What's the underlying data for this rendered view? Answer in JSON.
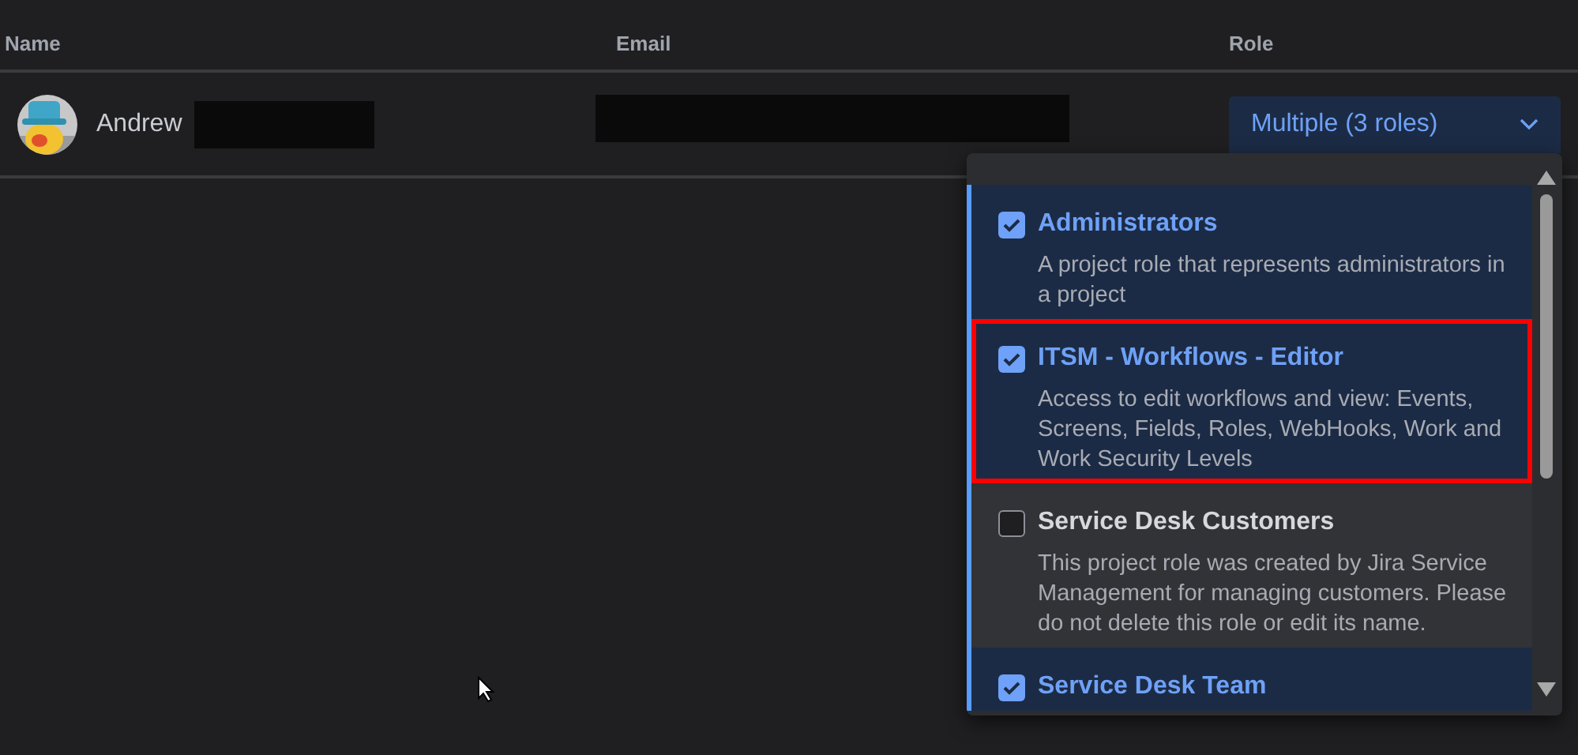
{
  "table": {
    "columns": [
      "Name",
      "Email",
      "Role"
    ],
    "rows": [
      {
        "name": "Andrew",
        "role_select": {
          "value": "Multiple (3 roles)",
          "expanded": true,
          "options": [
            {
              "label": "Administrators",
              "description": "A project role that represents administrators in a project",
              "checked": true,
              "annotated": false
            },
            {
              "label": "ITSM - Workflows - Editor",
              "description": "Access to edit workflows and view: Events, Screens, Fields, Roles, WebHooks, Work and Work Security Levels",
              "checked": true,
              "annotated": true
            },
            {
              "label": "Service Desk Customers",
              "description": "This project role was created by Jira Service Management for managing customers. Please do not delete this role or edit its name.",
              "checked": false,
              "annotated": false
            },
            {
              "label": "Service Desk Team",
              "checked": true,
              "annotated": false
            }
          ]
        }
      }
    ]
  }
}
